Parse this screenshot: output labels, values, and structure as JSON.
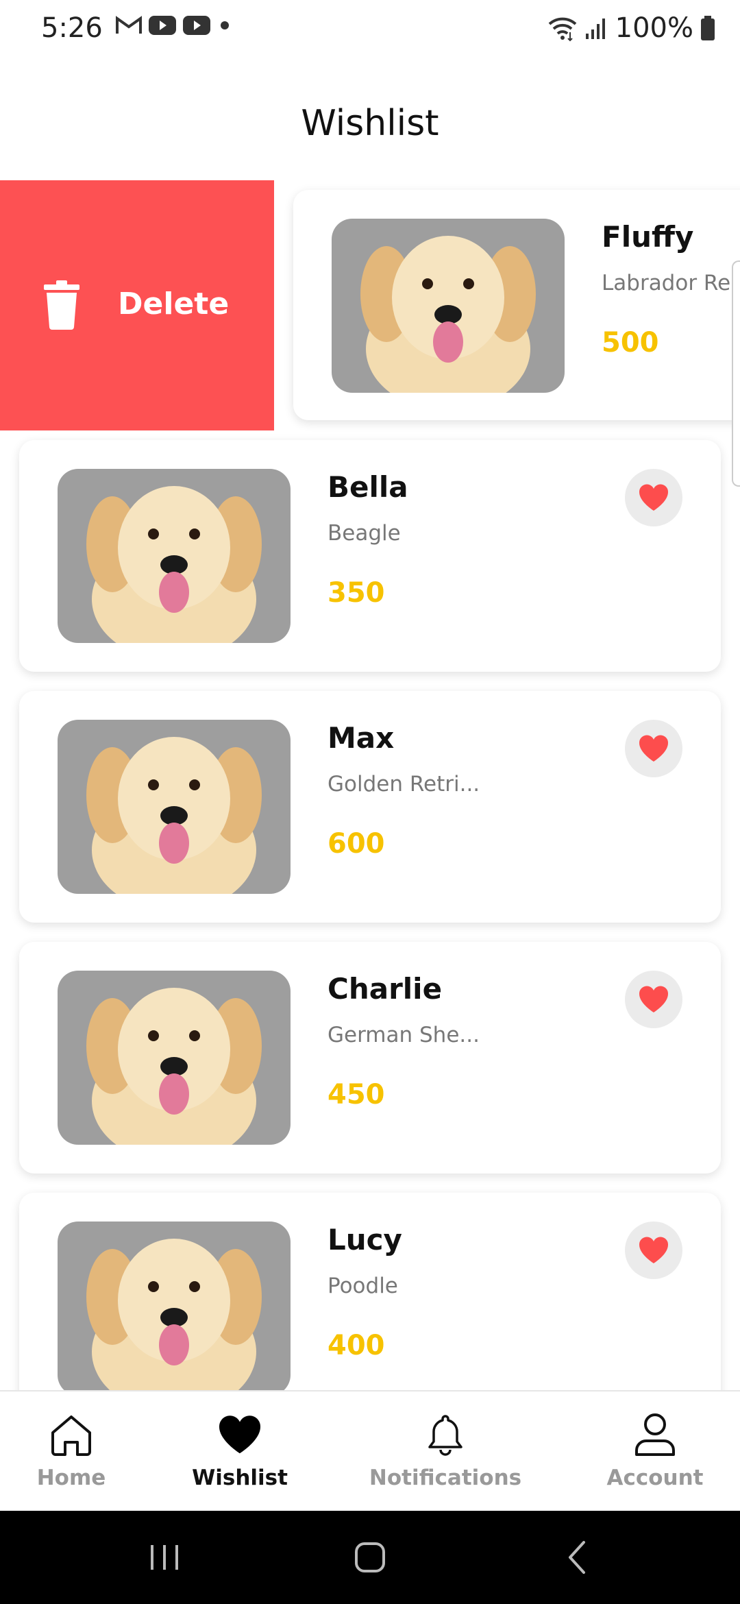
{
  "status_bar": {
    "time": "5:26",
    "battery": "100%",
    "notification_icons": [
      "gmail-icon",
      "youtube-icon",
      "youtube-icon",
      "dot-icon"
    ]
  },
  "header": {
    "title": "Wishlist"
  },
  "swipe_action": {
    "label": "Delete",
    "color": "#fd5153"
  },
  "wishlist": [
    {
      "name": "Fluffy",
      "breed": "Labrador Re...",
      "price": "500"
    },
    {
      "name": "Bella",
      "breed": "Beagle",
      "price": "350"
    },
    {
      "name": "Max",
      "breed": "Golden Retri...",
      "price": "600"
    },
    {
      "name": "Charlie",
      "breed": "German She...",
      "price": "450"
    },
    {
      "name": "Lucy",
      "breed": "Poodle",
      "price": "400"
    }
  ],
  "bottom_nav": {
    "items": [
      {
        "label": "Home",
        "icon": "home-icon",
        "active": false
      },
      {
        "label": "Wishlist",
        "icon": "heart-icon",
        "active": true
      },
      {
        "label": "Notifications",
        "icon": "bell-icon",
        "active": false
      },
      {
        "label": "Account",
        "icon": "user-icon",
        "active": false
      }
    ]
  },
  "colors": {
    "accent_price": "#f7c200",
    "heart": "#fd4d4d",
    "delete": "#fd5153"
  }
}
